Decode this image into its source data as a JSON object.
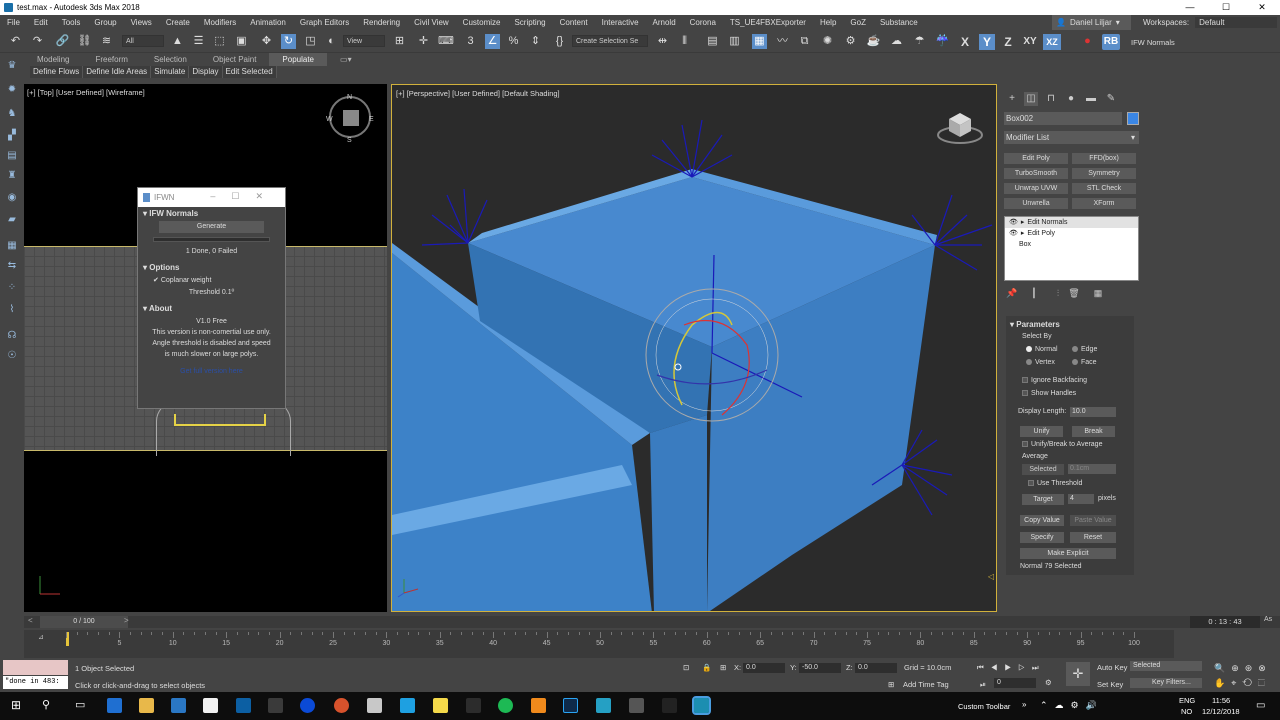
{
  "window": {
    "title": "test.max - Autodesk 3ds Max 2018",
    "min": "—",
    "max": "☐",
    "close": "✕"
  },
  "menu": {
    "items": [
      "File",
      "Edit",
      "Tools",
      "Group",
      "Views",
      "Create",
      "Modifiers",
      "Animation",
      "Graph Editors",
      "Rendering",
      "Civil View",
      "Customize",
      "Scripting",
      "Content",
      "Interactive",
      "Arnold",
      "Corona",
      "TS_UE4FBXExporter",
      "Help",
      "GoZ",
      "Substance"
    ],
    "user": "Daniel Liljar",
    "workspaces_label": "Workspaces:",
    "workspaces_value": "Default"
  },
  "toolbar": {
    "selection_filter": "All",
    "ref_coord": "View",
    "named_selection": "Create Selection Se",
    "axis_x": "X",
    "axis_y": "Y",
    "axis_z": "Z",
    "axis_xy": "XY",
    "rb": "RB",
    "ifw_label": "IFW Normals"
  },
  "ribbon": {
    "tabs": [
      "Modeling",
      "Freeform",
      "Selection",
      "Object Paint",
      "Populate"
    ],
    "active_tab": "Populate",
    "subtabs": [
      "Define Flows",
      "Define Idle Areas",
      "Simulate",
      "Display",
      "Edit Selected"
    ]
  },
  "viewport_top": {
    "label": "[+] [Top] [User Defined] [Wireframe]",
    "compass": {
      "n": "N",
      "s": "S",
      "e": "E",
      "w": "W"
    }
  },
  "viewport_persp": {
    "label": "[+] [Perspective] [User Defined] [Default Shading]"
  },
  "ifw_dialog": {
    "title": "IFWN",
    "section_normals": "IFW Normals",
    "generate": "Generate",
    "status": "1 Done, 0 Failed",
    "section_options": "Options",
    "coplanar": "Coplanar weight",
    "threshold": "Threshold 0.1º",
    "section_about": "About",
    "version": "V1.0 Free",
    "about_text_1": "This version is non-comertial use only.",
    "about_text_2": "Angle threshold is disabled and speed",
    "about_text_3": "is much slower on large polys.",
    "link": "Get full version here"
  },
  "command_panel": {
    "object_name": "Box002",
    "object_color": "#3a86e5",
    "modifier_list": "Modifier List",
    "modifier_buttons": [
      "Edit Poly",
      "FFD(box)",
      "TurboSmooth",
      "Symmetry",
      "Unwrap UVW",
      "STL Check",
      "Unwrella",
      "XForm"
    ],
    "stack": [
      "Edit Normals",
      "Edit Poly",
      "Box"
    ]
  },
  "parameters": {
    "header": "Parameters",
    "select_by": "Select By",
    "normal": "Normal",
    "edge": "Edge",
    "vertex": "Vertex",
    "face": "Face",
    "ignore_backfacing": "Ignore Backfacing",
    "show_handles": "Show Handles",
    "display_length_label": "Display Length:",
    "display_length_value": "10.0",
    "unify": "Unify",
    "break": "Break",
    "unify_break_avg": "Unify/Break to Average",
    "average": "Average",
    "selected": "Selected",
    "selected_value": "0.1cm",
    "use_threshold": "Use Threshold",
    "target": "Target",
    "target_value": "4",
    "pixels": "pixels",
    "copy_value": "Copy Value",
    "paste_value": "Paste Value",
    "specify": "Specify",
    "reset": "Reset",
    "make_explicit": "Make Explicit",
    "normal_selected": "Normal 79 Selected"
  },
  "timeline": {
    "frame": "0 / 100",
    "ticks": [
      "5",
      "10",
      "15",
      "20",
      "25",
      "30",
      "35",
      "40",
      "45",
      "50",
      "55",
      "60",
      "65",
      "70",
      "75",
      "80",
      "85",
      "90",
      "95",
      "100"
    ],
    "time_display": "0 : 13 : 43"
  },
  "status": {
    "maxscript_output": "\"done in 483:",
    "selected": "1 Object Selected",
    "prompt": "Click or click-and-drag to select objects",
    "x_label": "X:",
    "x": "0.0",
    "y_label": "Y:",
    "y": "-50.0",
    "z_label": "Z:",
    "z": "0.0",
    "grid": "Grid = 10.0cm",
    "add_time_tag": "Add Time Tag",
    "auto_key": "Auto Key",
    "auto_key_value": "Selected",
    "set_key": "Set Key",
    "key_filters": "Key Filters...",
    "frame_value": "0"
  },
  "taskbar": {
    "custom_toolbar": "Custom Toolbar",
    "lang": "ENG",
    "region": "NO",
    "time": "11:56",
    "date": "12/12/2018"
  }
}
